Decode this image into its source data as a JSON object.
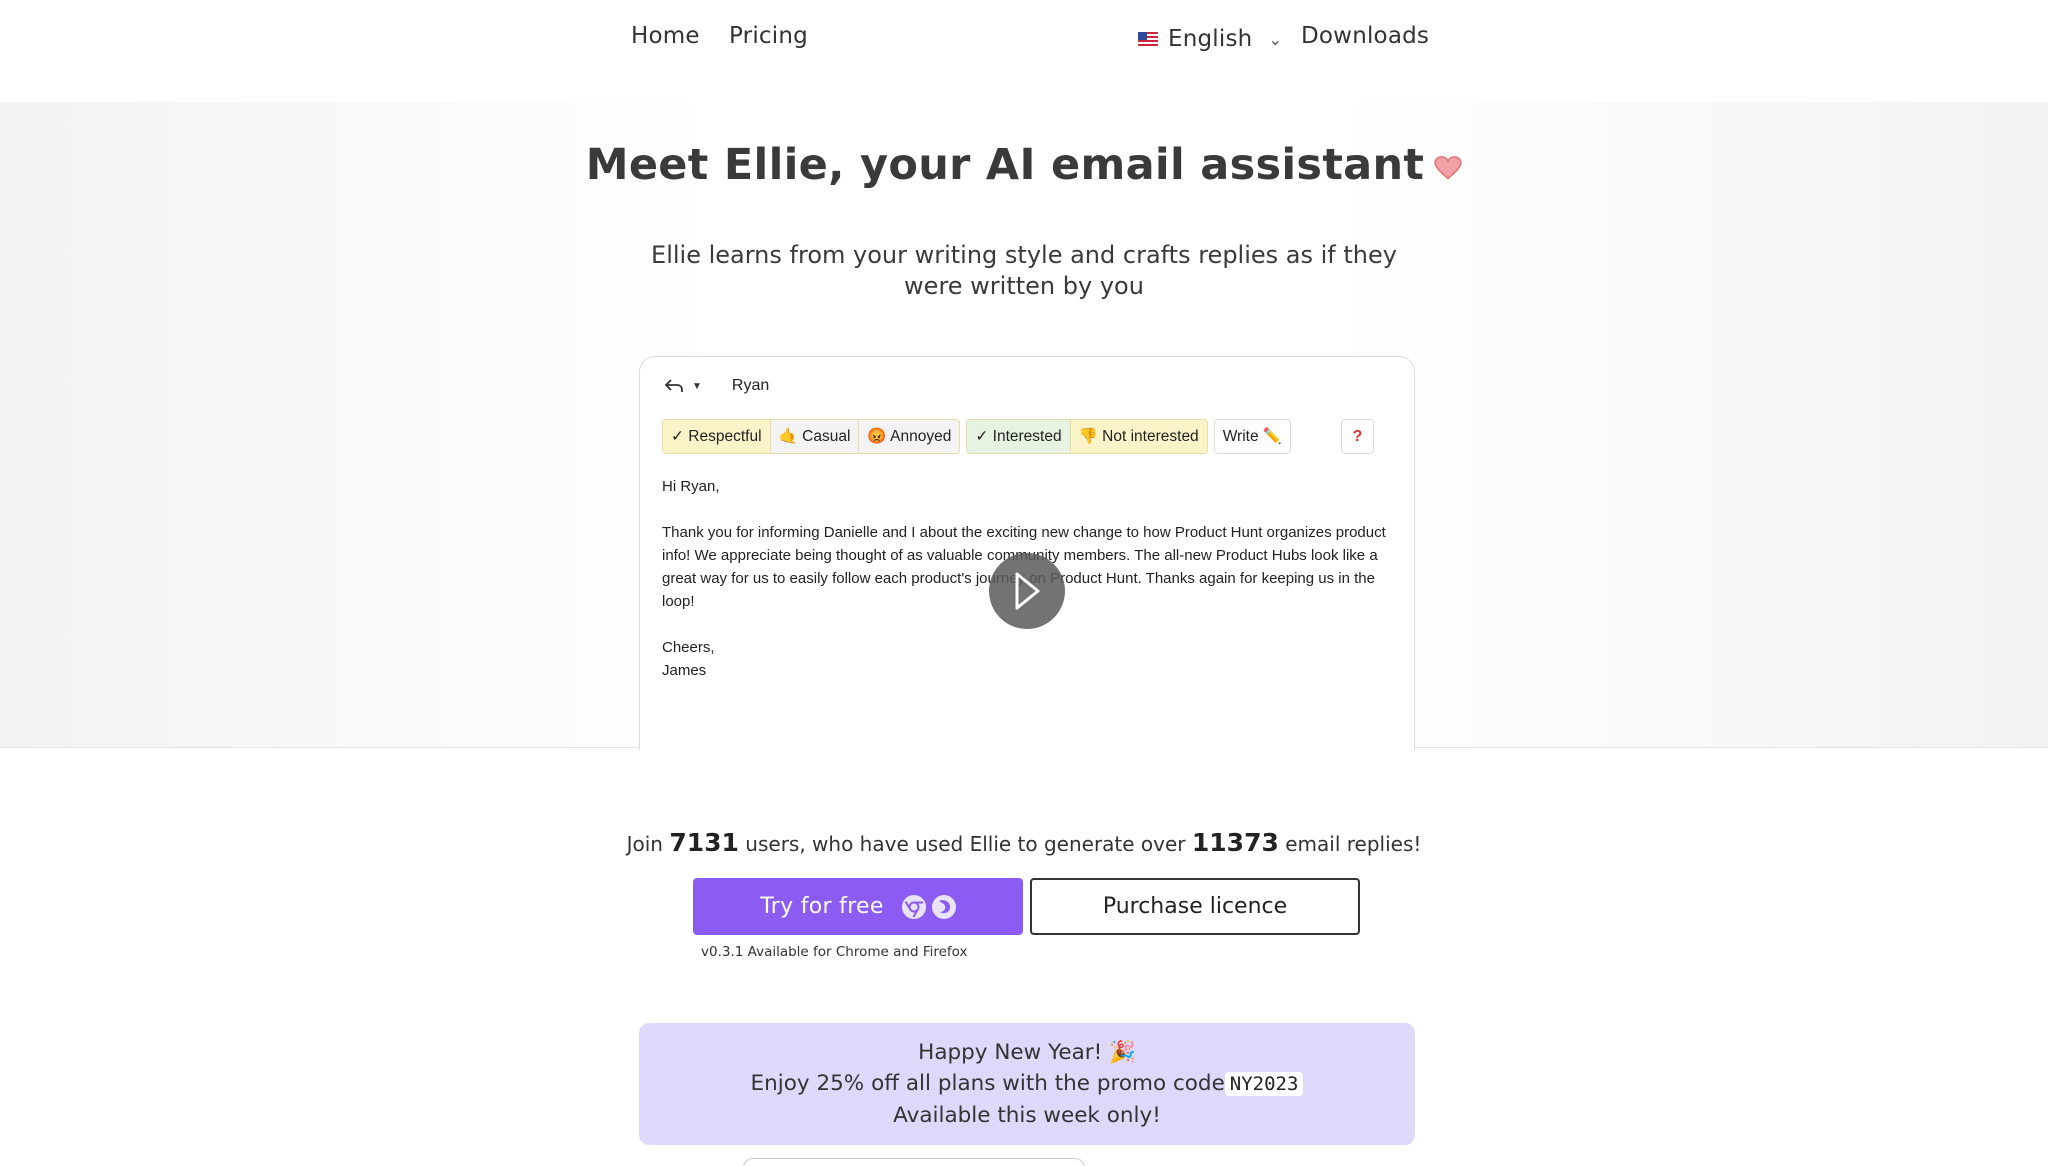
{
  "nav": {
    "home": "Home",
    "pricing": "Pricing",
    "language": "English",
    "downloads": "Downloads"
  },
  "hero": {
    "title": "Meet Ellie, your AI email assistant",
    "subtitle": "Ellie learns from your writing style and crafts replies as if they were written by you"
  },
  "demo": {
    "recipient": "Ryan",
    "tones": [
      "✓ Respectful",
      "🤙 Casual",
      "😡 Annoyed"
    ],
    "intents": [
      "✓ Interested",
      "👎 Not interested"
    ],
    "write": "Write ✏️",
    "help": "?",
    "email": {
      "greeting": "Hi Ryan,",
      "body": "Thank you for informing Danielle and I about the exciting new change to how Product Hunt organizes product info! We appreciate being thought of as valuable community members. The all-new Product Hubs look like a great way for us to easily follow each product's journey on Product Hunt. Thanks again for keeping us in the loop!",
      "signoff": "Cheers,",
      "signature": "James"
    }
  },
  "cta": {
    "join": "Join",
    "users": "7131",
    "middle": "users, who have used Ellie to generate over",
    "replies": "11373",
    "end": "email replies!",
    "try_label": "Try for free",
    "purchase_label": "Purchase licence",
    "version": "v0.3.1 Available for Chrome and Firefox"
  },
  "promo": {
    "line1": "Happy New Year! 🎉",
    "line2": "Enjoy 25% off all plans with the promo code",
    "code": "NY2023",
    "line3": "Available this week only!"
  },
  "colors": {
    "accent": "#8c5cf2",
    "promo_bg": "#ded8fb"
  }
}
